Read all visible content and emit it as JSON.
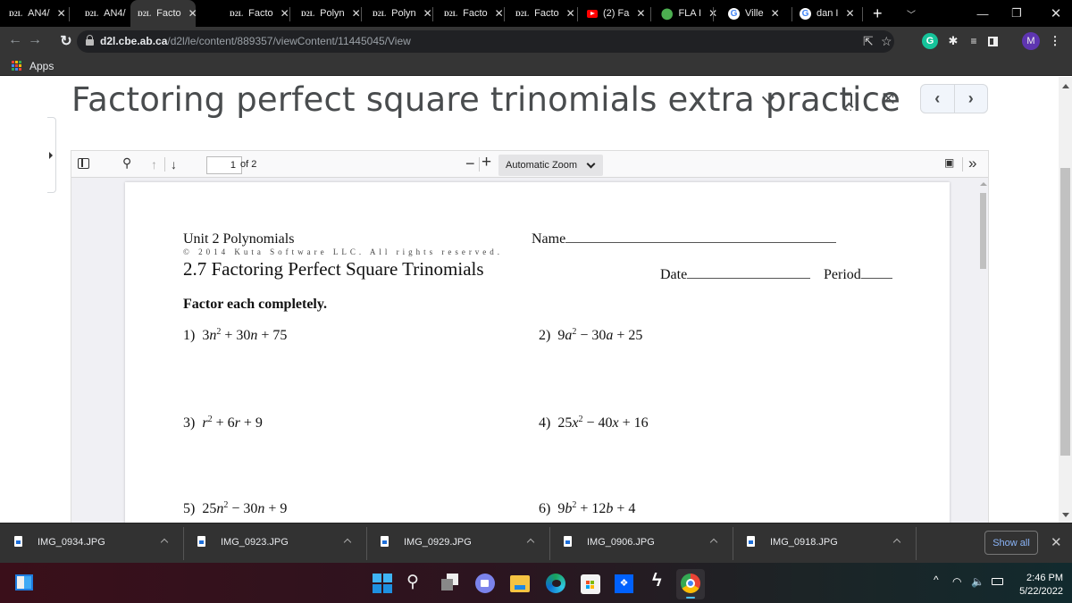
{
  "browser": {
    "tabs": [
      {
        "icon": "d2l-icon",
        "label": "AN4/"
      },
      {
        "icon": "d2l-icon",
        "label": "AN4/"
      },
      {
        "icon": "d2l-icon",
        "label": "Facto",
        "active": true
      },
      {
        "icon": "d2l-icon",
        "label": "Facto"
      },
      {
        "icon": "d2l-icon",
        "label": "Polyn"
      },
      {
        "icon": "d2l-icon",
        "label": "Polyn"
      },
      {
        "icon": "d2l-icon",
        "label": "Facto"
      },
      {
        "icon": "d2l-icon",
        "label": "Facto"
      },
      {
        "icon": "youtube-icon",
        "label": "(2) Fa"
      },
      {
        "icon": "google-maps-icon",
        "label": "FLA I"
      },
      {
        "icon": "google-icon",
        "label": "Ville"
      },
      {
        "icon": "google-icon",
        "label": "dan I"
      }
    ],
    "tab_favicon_text": "D2L",
    "new_tab": "+",
    "tab_close": "✕",
    "url_host": "d2l.cbe.ab.ca",
    "url_path": "/d2l/le/content/889357/viewContent/11445045/View",
    "profile_initial": "M",
    "grammarly_initial": "G",
    "bookmarks": {
      "apps_label": "Apps"
    }
  },
  "content": {
    "title": "Factoring perfect square trinomials extra practice"
  },
  "pdf_viewer": {
    "page_current": "1",
    "page_total_label": "of 2",
    "zoom_label": "Automatic Zoom",
    "zoom_out": "−",
    "zoom_in": "+",
    "more": "»"
  },
  "document": {
    "unit": "Unit 2 Polynomials",
    "copyright": "© 2014 Kuta Software LLC.  All rights reserved.",
    "heading": "2.7 Factoring Perfect Square Trinomials",
    "name_label": "Name",
    "date_label": "Date",
    "period_label": "Period",
    "instructions": "Factor each completely.",
    "problems": [
      {
        "num": "1)",
        "coef": "3",
        "var": "n",
        "mid": " + 30",
        "const": " + 75"
      },
      {
        "num": "2)",
        "coef": "9",
        "var": "a",
        "mid": " − 30",
        "const": " + 25"
      },
      {
        "num": "3)",
        "coef": "",
        "var": "r",
        "mid": " + 6",
        "const": " + 9"
      },
      {
        "num": "4)",
        "coef": "25",
        "var": "x",
        "mid": " − 40",
        "const": " + 16"
      },
      {
        "num": "5)",
        "coef": "25",
        "var": "n",
        "mid": " − 30",
        "const": " + 9"
      },
      {
        "num": "6)",
        "coef": "9",
        "var": "b",
        "mid": " + 12",
        "const": " + 4"
      }
    ],
    "exponent": "2"
  },
  "downloads": {
    "items": [
      "IMG_0934.JPG",
      "IMG_0923.JPG",
      "IMG_0929.JPG",
      "IMG_0906.JPG",
      "IMG_0918.JPG"
    ],
    "show_all": "Show all"
  },
  "taskbar": {
    "time": "2:46 PM",
    "date": "5/22/2022",
    "apps": [
      "windows-start-icon",
      "search-icon",
      "task-view-icon",
      "teams-chat-icon",
      "file-explorer-icon",
      "edge-icon",
      "microsoft-store-icon",
      "dropbox-icon",
      "winamp-icon",
      "chrome-icon"
    ]
  }
}
